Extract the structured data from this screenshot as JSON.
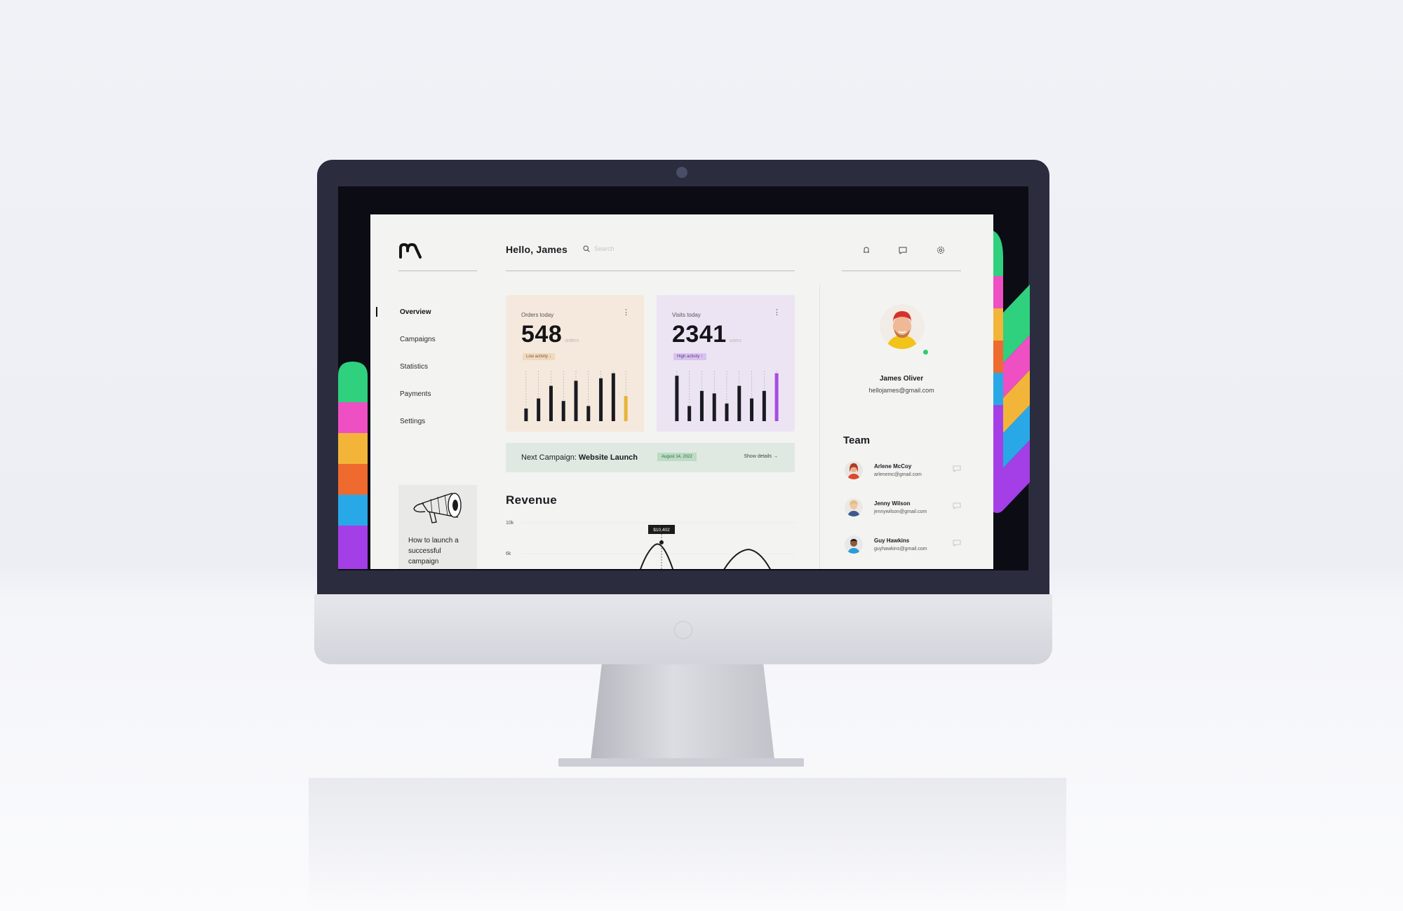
{
  "header": {
    "greeting": "Hello, James",
    "search_placeholder": "Search"
  },
  "sidebar": {
    "items": [
      {
        "label": "Overview",
        "active": true
      },
      {
        "label": "Campaigns",
        "active": false
      },
      {
        "label": "Statistics",
        "active": false
      },
      {
        "label": "Payments",
        "active": false
      },
      {
        "label": "Settings",
        "active": false
      }
    ],
    "promo_text": "How to launch a successful campaign"
  },
  "orders_card": {
    "label": "Orders today",
    "value": "548",
    "unit": "orders",
    "badge": "Low activity ↓",
    "bars": [
      0.25,
      0.45,
      0.7,
      0.4,
      0.8,
      0.3,
      0.85,
      0.95,
      0.5
    ],
    "accent": "#e8b33a"
  },
  "visits_card": {
    "label": "Visits today",
    "value": "2341",
    "unit": "users",
    "badge": "High activity ↑",
    "bars": [
      0.9,
      0.3,
      0.6,
      0.55,
      0.35,
      0.7,
      0.45,
      0.6,
      0.95
    ],
    "accent": "#a64de0"
  },
  "campaign": {
    "prefix": "Next Campaign:",
    "name": "Website Launch",
    "date": "August 14, 2022",
    "link": "Show details →"
  },
  "revenue": {
    "title": "Revenue",
    "y_ticks": [
      "10k",
      "6k"
    ],
    "tooltip": "$10,402"
  },
  "profile": {
    "name": "James Oliver",
    "email": "hellojames@gmail.com"
  },
  "team": {
    "title": "Team",
    "members": [
      {
        "name": "Arlene McCoy",
        "email": "arlenemc@gmail.com"
      },
      {
        "name": "Jenny Wilson",
        "email": "jennywilson@gmail.com"
      },
      {
        "name": "Guy Hawkins",
        "email": "guyhawkins@gmail.com"
      }
    ]
  },
  "icons": [
    "brand-logo-icon",
    "search-icon",
    "notification-icon",
    "message-icon",
    "settings-icon",
    "more-vertical-icon",
    "chat-bubble-icon",
    "megaphone-icon"
  ],
  "colors": {
    "accent_green": "#2ecc71",
    "deco": [
      "#2fd07e",
      "#ee4fc3",
      "#f2b53a",
      "#ee6a2e",
      "#29a8e8",
      "#a43ee6"
    ]
  }
}
